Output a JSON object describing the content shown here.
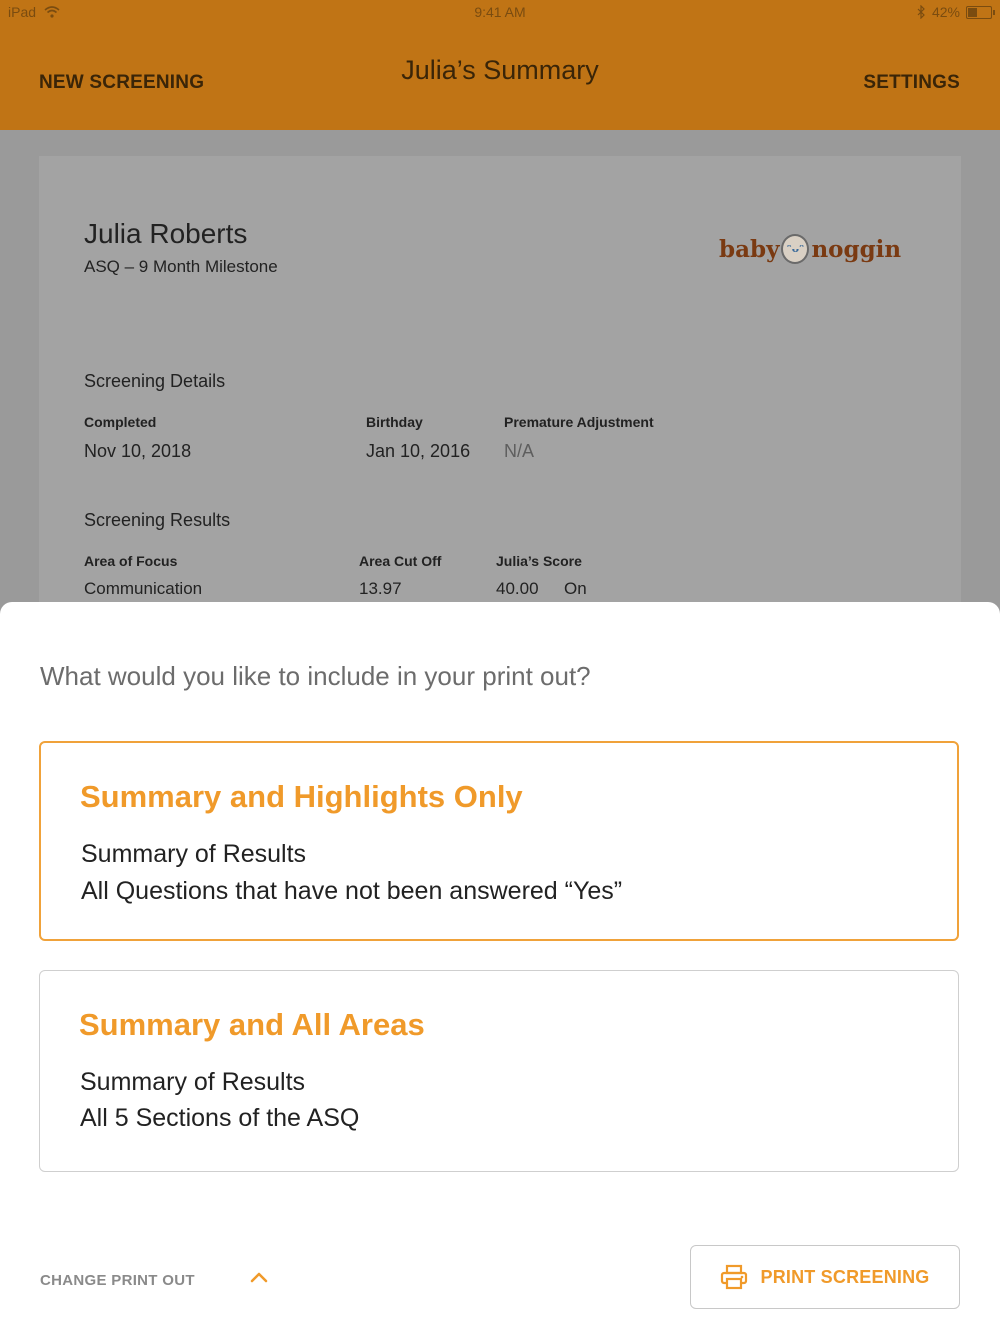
{
  "status_bar": {
    "device": "iPad",
    "time": "9:41 AM",
    "battery": "42%",
    "battery_level": 0.42,
    "icons": [
      "wifi-icon",
      "bluetooth-icon",
      "battery-icon"
    ]
  },
  "nav": {
    "left": "NEW SCREENING",
    "title": "Julia’s Summary",
    "right": "SETTINGS"
  },
  "summary": {
    "name": "Julia Roberts",
    "subtitle": "ASQ – 9 Month Milestone",
    "logo_left": "baby",
    "logo_right": "noggin",
    "details_title": "Screening Details",
    "details": {
      "completed_label": "Completed",
      "completed_value": "Nov 10, 2018",
      "birthday_label": "Birthday",
      "birthday_value": "Jan 10, 2016",
      "premature_label": "Premature Adjustment",
      "premature_value": "N/A"
    },
    "results_title": "Screening Results",
    "results": {
      "area_label": "Area of Focus",
      "cutoff_label": "Area Cut Off",
      "score_label": "Julia’s Score",
      "rows": [
        {
          "area": "Communication",
          "cutoff": "13.97",
          "score": "40.00",
          "status": "On"
        }
      ]
    }
  },
  "sheet": {
    "prompt": "What would you like to include in your print out?",
    "options": [
      {
        "title": "Summary and Highlights Only",
        "lines": [
          "Summary of Results",
          "All Questions that have not been answered “Yes”"
        ],
        "selected": true
      },
      {
        "title": "Summary and All Areas",
        "lines": [
          "Summary of Results",
          "All 5 Sections of the ASQ"
        ],
        "selected": false
      }
    ],
    "change_label": "CHANGE PRINT OUT",
    "print_label": "PRINT SCREENING"
  },
  "colors": {
    "header": "#c07415",
    "accent": "#f09a2a",
    "selected_border": "#f0a23a"
  }
}
